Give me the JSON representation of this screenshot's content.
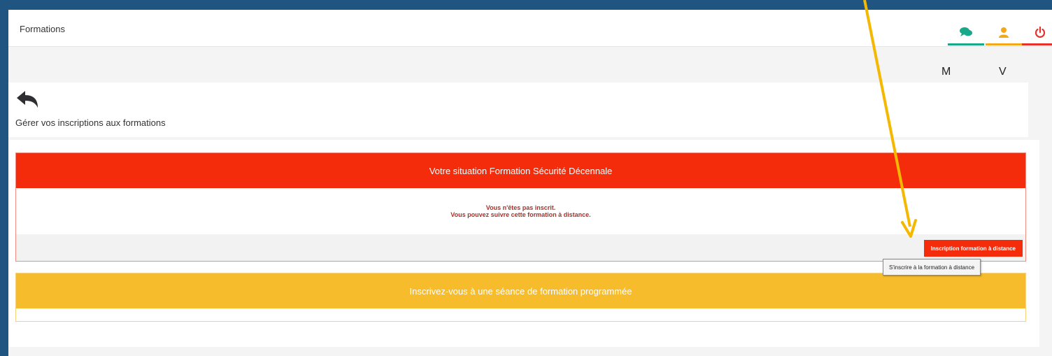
{
  "header": {
    "title": "Formations",
    "icons": [
      "chat-icon",
      "user-icon",
      "power-icon"
    ],
    "icon_colors": {
      "chat": "#1aa88a",
      "user": "#f3a81b",
      "power": "#e8302a"
    }
  },
  "user_initials": [
    "M",
    "V"
  ],
  "page": {
    "back_icon": "back-arrow-icon",
    "title": "Gérer vos inscriptions aux formations"
  },
  "situation": {
    "title": "Votre situation Formation Sécurité Décennale",
    "message_line1": "Vous n'êtes pas inscrit.",
    "message_line2": "Vous pouvez suivre cette formation à distance.",
    "button_label": "Inscription formation à distance",
    "accent_color": "#f52c0b"
  },
  "tooltip": "S'inscrire à la formation à distance",
  "scheduled": {
    "title": "Inscrivez-vous à une séance de formation programmée",
    "accent_color": "#f7bc2c"
  },
  "annotation": {
    "arrow_color": "#f5b800"
  }
}
